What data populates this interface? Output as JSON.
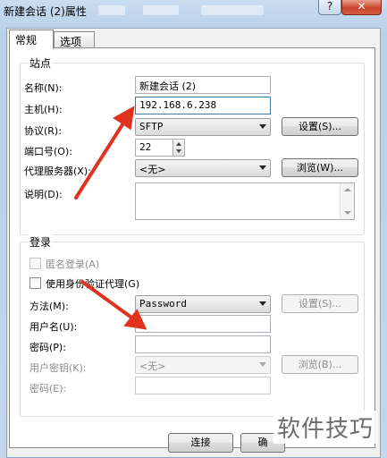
{
  "window": {
    "title": "新建会话 (2)属性",
    "help_glyph": "?",
    "close_glyph": "✕"
  },
  "tabs": [
    {
      "label": "常规",
      "active": true
    },
    {
      "label": "选项",
      "active": false
    }
  ],
  "site": {
    "group_title": "站点",
    "name_label": "名称(N):",
    "name_value": "新建会话 (2)",
    "host_label": "主机(H):",
    "host_value": "192.168.6.238",
    "protocol_label": "协议(R):",
    "protocol_value": "SFTP",
    "settings_btn": "设置(S)...",
    "port_label": "端口号(O):",
    "port_value": "22",
    "proxy_label": "代理服务器(X):",
    "proxy_value": "<无>",
    "browse_btn": "浏览(W)...",
    "desc_label": "说明(D):"
  },
  "login": {
    "group_title": "登录",
    "anon_label": "匿名登录(A)",
    "agent_label": "使用身份验证代理(G)",
    "method_label": "方法(M):",
    "method_value": "Password",
    "settings_btn": "设置(S)...",
    "username_label": "用户名(U):",
    "password_label": "密码(P):",
    "userkey_label": "用户密钥(K):",
    "userkey_value": "<无>",
    "browse_btn": "浏览(B)...",
    "passphrase_label": "密码(E):"
  },
  "footer": {
    "connect_btn": "连接",
    "ok_btn_partial": "确"
  },
  "watermark": "软件技巧",
  "colors": {
    "annotation_arrow": "#e0321e",
    "title_bar": "#c9dcf0"
  }
}
